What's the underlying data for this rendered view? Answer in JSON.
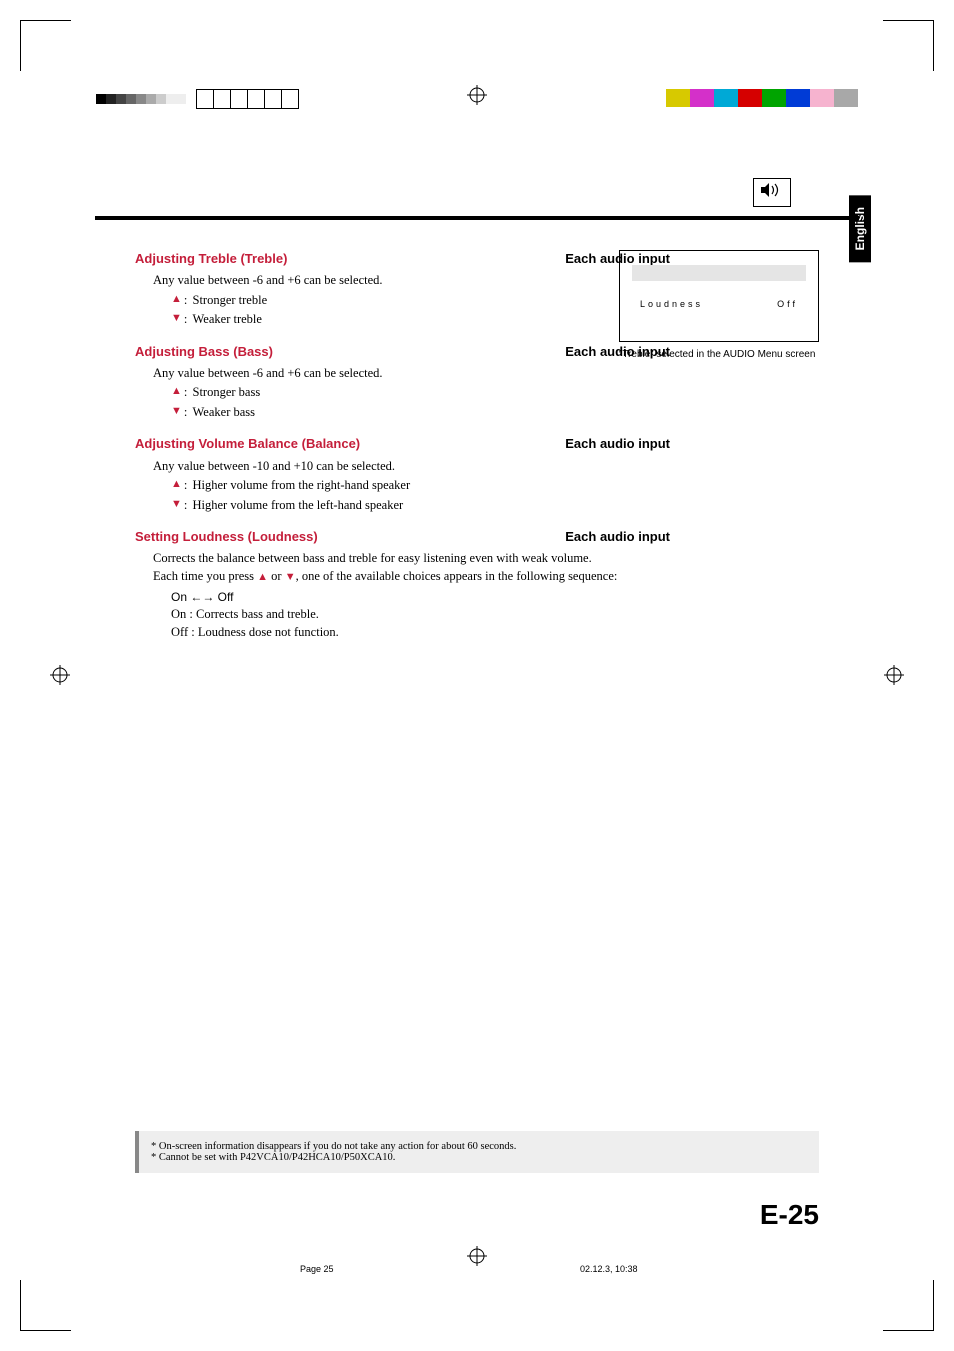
{
  "lang_tab": "English",
  "speaker_icon_name": "speaker-icon",
  "sections": {
    "treble": {
      "heading": "Adjusting Treble (Treble)",
      "scope": "Each  audio input",
      "body": "Any value between -6 and +6 can be selected.",
      "up": "Stronger treble",
      "down": "Weaker treble"
    },
    "bass": {
      "heading": "Adjusting Bass (Bass)",
      "scope": "Each  audio input",
      "body": "Any value between -6 and +6 can be selected.",
      "up": "Stronger bass",
      "down": "Weaker bass"
    },
    "balance": {
      "heading": "Adjusting Volume Balance (Balance)",
      "scope": "Each  audio input",
      "body": "Any value between -10 and +10 can be selected.",
      "up": "Higher volume from the right-hand speaker",
      "down": "Higher volume from the left-hand speaker"
    },
    "loudness": {
      "heading": "Setting Loudness (Loudness)",
      "scope": "Each  audio input",
      "body1": "Corrects the balance between bass and treble for easy listening even with weak volume.",
      "body2_pre": "Each time you press ",
      "body2_post": ", one of the available choices appears in the following sequence:",
      "toggle": "On ↔ Off",
      "on_desc": "On : Corrects bass and treble.",
      "off_desc": "Off : Loudness dose not function."
    }
  },
  "menu_preview": {
    "label": "Loudness",
    "value": "Off"
  },
  "preview_caption": "“Treble” selected in the AUDIO Menu screen",
  "notes": {
    "n1": "* On-screen information disappears if you do not take any action for about 60 seconds.",
    "n2": "* Cannot be set with P42VCA10/P42HCA10/P50XCA10."
  },
  "page_number": "E-25",
  "footer": {
    "page": "Page 25",
    "timestamp": "02.12.3, 10:38"
  },
  "color_bar_right": [
    "#d7c900",
    "#d430c9",
    "#00a9d6",
    "#d50000",
    "#00a400",
    "#003bd6",
    "#f6b3cf",
    "#a8a8a8"
  ]
}
